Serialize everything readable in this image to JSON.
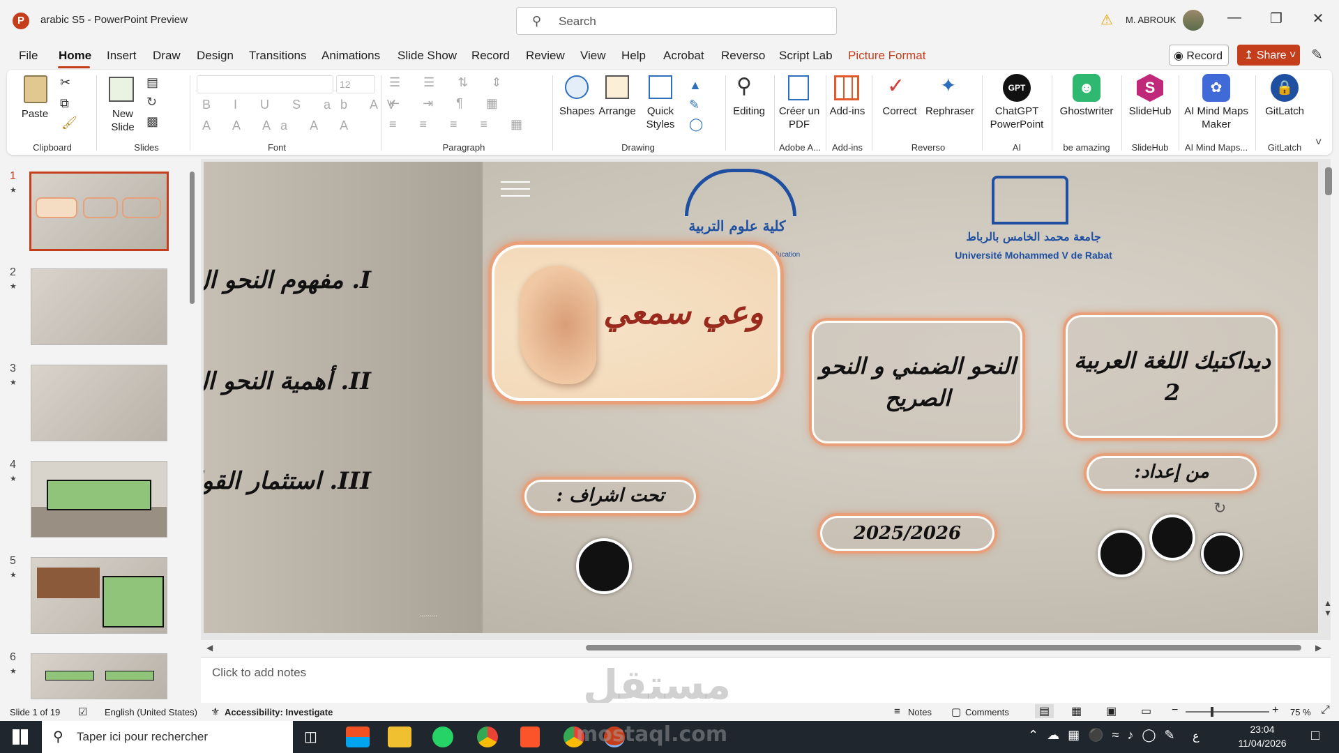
{
  "app": {
    "doc_title": "arabic S5",
    "app_name": "PowerPoint Preview",
    "title_full": "arabic S5  -  PowerPoint Preview"
  },
  "search": {
    "placeholder": "Search"
  },
  "user": {
    "name": "M. ABROUK"
  },
  "menu": {
    "tabs": [
      "File",
      "Home",
      "Insert",
      "Draw",
      "Design",
      "Transitions",
      "Animations",
      "Slide Show",
      "Record",
      "Review",
      "View",
      "Help",
      "Acrobat",
      "Reverso",
      "Script Lab",
      "Picture Format"
    ],
    "active": "Home"
  },
  "toolbar": {
    "record_label": "Record",
    "share_label": "Share"
  },
  "ribbon": {
    "clipboard": {
      "paste": "Paste",
      "group": "Clipboard"
    },
    "slides": {
      "new_slide": "New Slide",
      "group": "Slides"
    },
    "font": {
      "size": "12",
      "group": "Font"
    },
    "paragraph": {
      "group": "Paragraph"
    },
    "drawing": {
      "shapes": "Shapes",
      "arrange": "Arrange",
      "quick_styles": "Quick Styles",
      "group": "Drawing"
    },
    "editing": {
      "label": "Editing"
    },
    "adobe": {
      "create_pdf": "Créer un PDF",
      "group": "Adobe A..."
    },
    "addins": {
      "label": "Add-ins",
      "group": "Add-ins"
    },
    "reverso": {
      "correct": "Correct",
      "rephraser": "Rephraser",
      "group": "Reverso"
    },
    "ai": {
      "chatgpt": "ChatGPT PowerPoint",
      "group": "AI"
    },
    "ghostwriter": {
      "label": "Ghostwriter",
      "group": "be amazing"
    },
    "slidehub": {
      "label": "SlideHub",
      "group": "SlideHub"
    },
    "aimind": {
      "label": "AI Mind Maps Maker",
      "group": "AI Mind Maps..."
    },
    "gitlatch": {
      "label": "GitLatch",
      "group": "GitLatch"
    }
  },
  "thumbnails": {
    "numbers": [
      "1",
      "2",
      "3",
      "4",
      "5",
      "6"
    ]
  },
  "slide": {
    "faculty_ar": "كلية علوم التربية",
    "faculty_fr": "Faculté des Sciences de l'Education",
    "university_ar": "جامعة محمد الخامس بالرباط",
    "university_fr": "Université Mohammed V de Rabat",
    "left_items": [
      "I.   مفهوم النحو ال",
      "II.   أهمية النحو ال",
      "III. استثمار القواعد"
    ],
    "title_box": "النحو الضمني و النحو الصريح",
    "subject_box": "ديداكتيك اللغة العربية 2",
    "prepared_by": "من إعداد:",
    "supervised": "تحت اشراف :",
    "year": "2025/2026",
    "ornament_text": "وعي سمعي"
  },
  "notes": {
    "placeholder": "Click to add notes"
  },
  "status": {
    "slide_count": "Slide 1 of 19",
    "language": "English (United States)",
    "accessibility": "Accessibility: Investigate",
    "notes": "Notes",
    "comments": "Comments",
    "zoom": "75 %"
  },
  "taskbar": {
    "search_placeholder": "Taper ici pour rechercher",
    "time": "23:04",
    "date": "11/04/2026",
    "lang": "ع"
  },
  "watermark": {
    "ar": "مستقل",
    "en": "mostaql.com"
  },
  "colors": {
    "accent": "#c43e1c",
    "box_border": "#e8a07a",
    "logo_blue": "#1e4fa0"
  }
}
